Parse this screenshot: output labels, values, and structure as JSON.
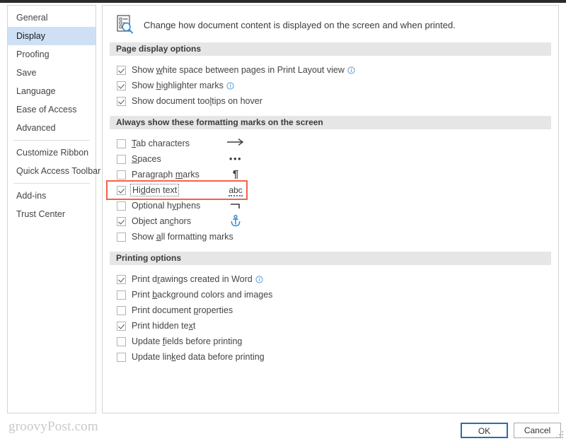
{
  "dialog": {
    "header": {
      "icon": "document-magnifier-icon",
      "description": "Change how document content is displayed on the screen and when printed."
    }
  },
  "sidebar": {
    "items": [
      {
        "label": "General",
        "selected": false
      },
      {
        "label": "Display",
        "selected": true
      },
      {
        "label": "Proofing",
        "selected": false
      },
      {
        "label": "Save",
        "selected": false
      },
      {
        "label": "Language",
        "selected": false
      },
      {
        "label": "Ease of Access",
        "selected": false
      },
      {
        "label": "Advanced",
        "selected": false
      },
      {
        "label": "Customize Ribbon",
        "selected": false
      },
      {
        "label": "Quick Access Toolbar",
        "selected": false
      },
      {
        "label": "Add-ins",
        "selected": false
      },
      {
        "label": "Trust Center",
        "selected": false
      }
    ]
  },
  "sections": {
    "page_display": {
      "title": "Page display options",
      "options": [
        {
          "pre": "Show ",
          "key": "w",
          "post": "hite space between pages in Print Layout view",
          "checked": true,
          "info": true
        },
        {
          "pre": "Show ",
          "key": "h",
          "post": "ighlighter marks",
          "checked": true,
          "info": true
        },
        {
          "pre": "Show document too",
          "key": "l",
          "post": "tips on hover",
          "checked": true,
          "info": false
        }
      ]
    },
    "formatting_marks": {
      "title": "Always show these formatting marks on the screen",
      "options": [
        {
          "pre": "",
          "key": "T",
          "post": "ab characters",
          "checked": false,
          "glyph": "→",
          "glyph_type": "arrow"
        },
        {
          "pre": "",
          "key": "S",
          "post": "paces",
          "checked": false,
          "glyph": "•••",
          "glyph_type": "dots"
        },
        {
          "pre": "Paragraph ",
          "key": "m",
          "post": "arks",
          "checked": false,
          "glyph": "¶",
          "glyph_type": "pilcrow"
        },
        {
          "pre": "Hi",
          "key": "d",
          "post": "den text",
          "checked": true,
          "glyph": "abc",
          "glyph_type": "abc",
          "focused": true,
          "highlighted": true
        },
        {
          "pre": "Optional h",
          "key": "y",
          "post": "phens",
          "checked": false,
          "glyph": "¬",
          "glyph_type": "hyphen"
        },
        {
          "pre": "Object an",
          "key": "c",
          "post": "hors",
          "checked": true,
          "glyph": "anchor-icon",
          "glyph_type": "anchor"
        },
        {
          "pre": "Show ",
          "key": "a",
          "post": "ll formatting marks",
          "checked": false,
          "glyph": "",
          "glyph_type": "none"
        }
      ]
    },
    "printing": {
      "title": "Printing options",
      "options": [
        {
          "pre": "Print d",
          "key": "r",
          "post": "awings created in Word",
          "checked": true,
          "info": true
        },
        {
          "pre": "Print ",
          "key": "b",
          "post": "ackground colors and images",
          "checked": false,
          "info": false
        },
        {
          "pre": "Print document ",
          "key": "p",
          "post": "roperties",
          "checked": false,
          "info": false
        },
        {
          "pre": "Print hidden te",
          "key": "x",
          "post": "t",
          "checked": true,
          "info": false
        },
        {
          "pre": "Update ",
          "key": "f",
          "post": "ields before printing",
          "checked": false,
          "info": false
        },
        {
          "pre": "Update lin",
          "key": "k",
          "post": "ed data before printing",
          "checked": false,
          "info": false
        }
      ]
    }
  },
  "footer": {
    "watermark": "groovyPost.com",
    "ok_label": "OK",
    "cancel_label": "Cancel"
  },
  "colors": {
    "selection": "#cfe0f5",
    "section_bar": "#e6e6e6",
    "callout_red": "#f4614a",
    "primary_border": "#2c6bb0",
    "accent_blue": "#2a7fd4"
  }
}
